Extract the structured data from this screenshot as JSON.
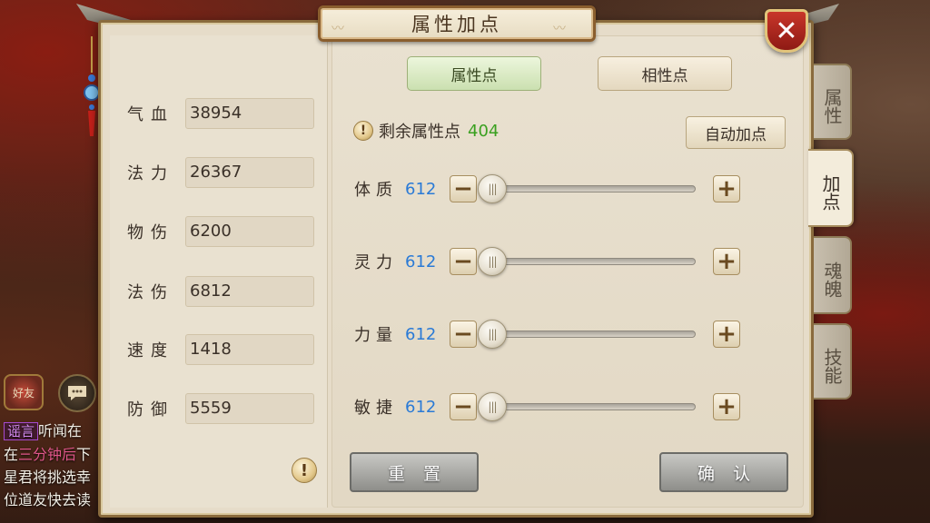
{
  "window": {
    "title": "属性加点",
    "close_label": "✕"
  },
  "chat": {
    "friend_label": "好友",
    "lines": [
      {
        "tag": "谣言",
        "text": "听闻在"
      },
      {
        "pre": "在",
        "highlight": "三分钟后",
        "post": "下"
      },
      {
        "text": "星君将挑选幸"
      },
      {
        "text": "位道友快去读"
      }
    ]
  },
  "stats": [
    {
      "label": "气血",
      "value": "38954"
    },
    {
      "label": "法力",
      "value": "26367"
    },
    {
      "label": "物伤",
      "value": "6200"
    },
    {
      "label": "法伤",
      "value": "6812"
    },
    {
      "label": "速度",
      "value": "1418"
    },
    {
      "label": "防御",
      "value": "5559"
    }
  ],
  "tabs": {
    "attr_points": "属性点",
    "affinity_points": "相性点"
  },
  "remaining": {
    "label": "剩余属性点",
    "value": "404"
  },
  "auto_assign_label": "自动加点",
  "attributes": [
    {
      "label": "体质",
      "value": "612",
      "slider_fraction": 0.0
    },
    {
      "label": "灵力",
      "value": "612",
      "slider_fraction": 0.0
    },
    {
      "label": "力量",
      "value": "612",
      "slider_fraction": 0.0
    },
    {
      "label": "敏捷",
      "value": "612",
      "slider_fraction": 0.0
    }
  ],
  "buttons": {
    "reset": "重置",
    "confirm": "确认"
  },
  "side_tabs": [
    {
      "label": "属性",
      "active": false
    },
    {
      "label": "加点",
      "active": true
    },
    {
      "label": "魂魄",
      "active": false
    },
    {
      "label": "技能",
      "active": false
    }
  ],
  "colors": {
    "accent_green": "#3aa020",
    "value_blue": "#2a7ad6"
  }
}
